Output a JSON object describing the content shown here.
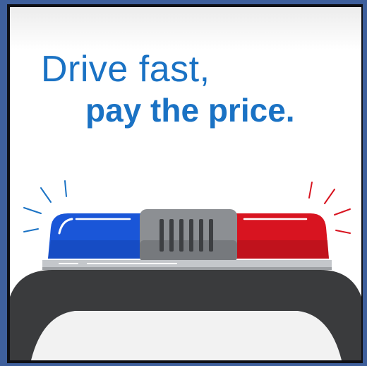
{
  "headline": {
    "line1": "Drive fast,",
    "line2": "pay the price."
  },
  "colors": {
    "text_blue": "#1a72c4",
    "siren_blue": "#1a56d8",
    "siren_red": "#d81420",
    "siren_gray": "#8c8f93",
    "car_roof": "#3a3b3d",
    "frame": "#3e5f9c"
  },
  "icons": [
    "police-siren-icon",
    "car-roof-icon"
  ]
}
